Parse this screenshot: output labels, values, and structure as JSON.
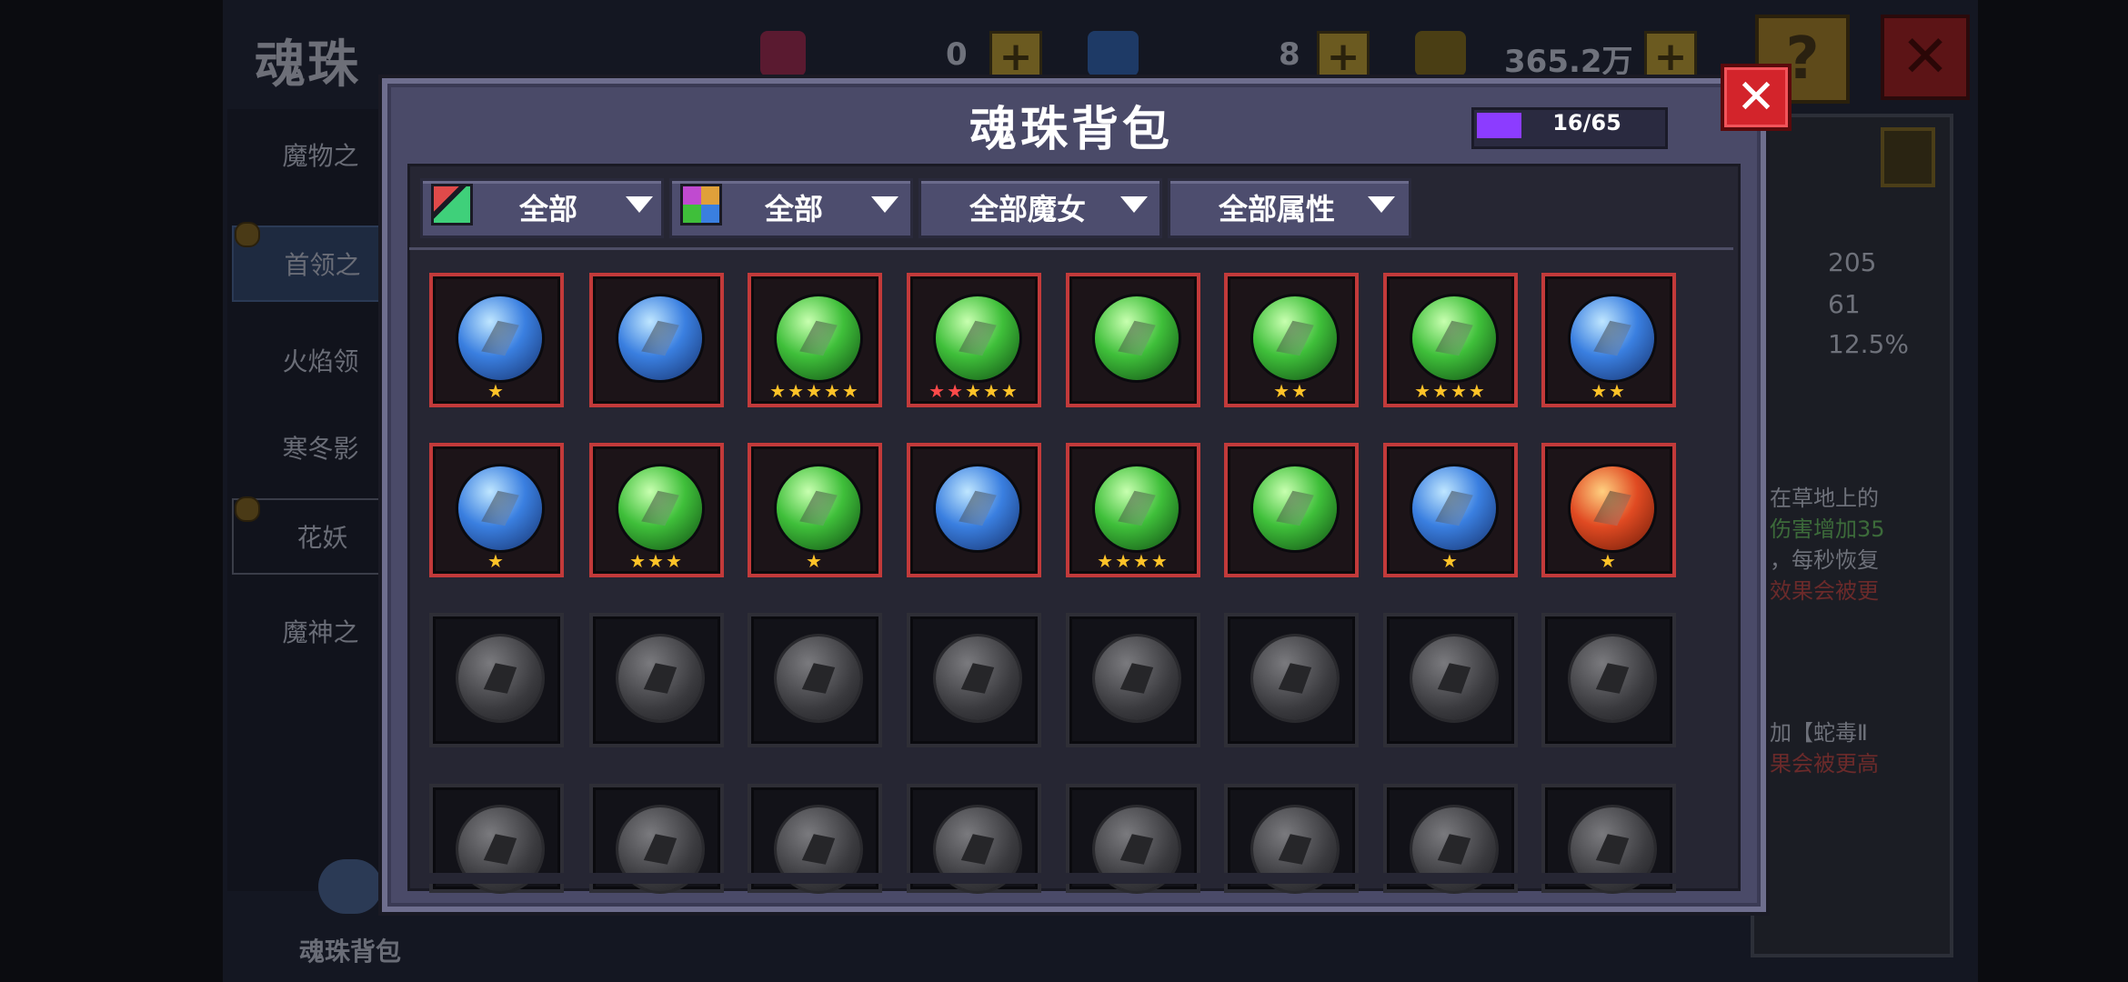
{
  "background": {
    "title": "魂珠",
    "currencies": [
      {
        "name": "pink-gem",
        "value": "0",
        "color": "#d0306a"
      },
      {
        "name": "blue-gem",
        "value": "8",
        "color": "#3a7fe0"
      },
      {
        "name": "gold-coin",
        "value": "365.2万",
        "color": "#d8b02a"
      }
    ],
    "help_label": "?",
    "close_label": "✕",
    "sidebar": [
      "魔物之",
      "首领之",
      "火焰领",
      "寒冬影",
      "花妖",
      "魔神之"
    ],
    "bag_shortcut_label": "魂珠背包",
    "stats": [
      "205",
      "61",
      "12.5%"
    ],
    "desc_lines": [
      "在草地上的",
      "伤害增加35",
      "，每秒恢复",
      "效果会被更",
      "加【蛇毒Ⅱ",
      "果会被更高"
    ]
  },
  "dialog": {
    "title": "魂珠背包",
    "capacity": {
      "text": "16/65",
      "used": 16,
      "total": 65,
      "color": "#8c3cff"
    },
    "close_label": "✕",
    "filters": [
      {
        "label": "全部",
        "icon": "rarity-color-icon"
      },
      {
        "label": "全部",
        "icon": "element-grid-icon"
      },
      {
        "label": "全部魔女",
        "icon": ""
      },
      {
        "label": "全部属性",
        "icon": ""
      }
    ]
  },
  "slots": [
    {
      "locked": false,
      "orb": "blue",
      "icon": "dark-blade-icon",
      "stars": 1,
      "red": 0
    },
    {
      "locked": false,
      "orb": "blue",
      "icon": "sword-icon",
      "stars": 0,
      "red": 0
    },
    {
      "locked": false,
      "orb": "green",
      "icon": "vine-creature-icon",
      "stars": 5,
      "red": 0
    },
    {
      "locked": false,
      "orb": "green",
      "icon": "skeleton-icon",
      "stars": 5,
      "red": 2
    },
    {
      "locked": false,
      "orb": "green",
      "icon": "leaf-staff-icon",
      "stars": 0,
      "red": 0
    },
    {
      "locked": false,
      "orb": "green",
      "icon": "serpent-icon",
      "stars": 2,
      "red": 0
    },
    {
      "locked": false,
      "orb": "green",
      "icon": "lizard-icon",
      "stars": 4,
      "red": 0
    },
    {
      "locked": false,
      "orb": "blue",
      "icon": "ice-axe-icon",
      "stars": 2,
      "red": 0
    },
    {
      "locked": false,
      "orb": "blue",
      "icon": "ice-bow-icon",
      "stars": 1,
      "red": 0
    },
    {
      "locked": false,
      "orb": "green",
      "icon": "thorn-staff-icon",
      "stars": 3,
      "red": 0
    },
    {
      "locked": false,
      "orb": "green",
      "icon": "cannon-icon",
      "stars": 1,
      "red": 0
    },
    {
      "locked": false,
      "orb": "blue",
      "icon": "dagger-icon",
      "stars": 0,
      "red": 0
    },
    {
      "locked": false,
      "orb": "green",
      "icon": "blade-leaf-icon",
      "stars": 4,
      "red": 0
    },
    {
      "locked": false,
      "orb": "green",
      "icon": "dark-sword-icon",
      "stars": 0,
      "red": 0
    },
    {
      "locked": false,
      "orb": "blue",
      "icon": "trident-icon",
      "stars": 1,
      "red": 0
    },
    {
      "locked": false,
      "orb": "red",
      "icon": "fire-beast-icon",
      "stars": 1,
      "red": 0
    },
    {
      "locked": true,
      "icon": "locked-orb-icon"
    },
    {
      "locked": true,
      "icon": "locked-orb-icon"
    },
    {
      "locked": true,
      "icon": "locked-orb-icon"
    },
    {
      "locked": true,
      "icon": "locked-orb-icon"
    },
    {
      "locked": true,
      "icon": "locked-orb-icon"
    },
    {
      "locked": true,
      "icon": "locked-orb-icon"
    },
    {
      "locked": true,
      "icon": "locked-orb-icon"
    },
    {
      "locked": true,
      "icon": "locked-orb-icon"
    },
    {
      "locked": true,
      "icon": "locked-orb-icon"
    },
    {
      "locked": true,
      "icon": "locked-orb-icon"
    },
    {
      "locked": true,
      "icon": "locked-orb-icon"
    },
    {
      "locked": true,
      "icon": "locked-orb-icon"
    },
    {
      "locked": true,
      "icon": "locked-orb-icon"
    },
    {
      "locked": true,
      "icon": "locked-orb-icon"
    },
    {
      "locked": true,
      "icon": "locked-orb-icon"
    },
    {
      "locked": true,
      "icon": "locked-orb-icon"
    }
  ],
  "orb_colors": {
    "blue": "#3a7fe0",
    "green": "#3fbf3a",
    "red": "#e04a22"
  }
}
